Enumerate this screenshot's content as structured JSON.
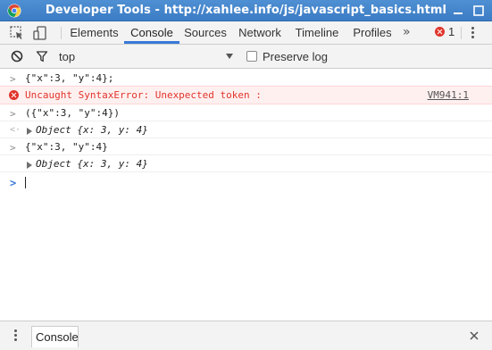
{
  "window": {
    "title": "Developer Tools - http://xahlee.info/js/javascript_basics.html"
  },
  "tabs": [
    {
      "label": "Elements"
    },
    {
      "label": "Console",
      "active": true
    },
    {
      "label": "Sources"
    },
    {
      "label": "Network"
    },
    {
      "label": "Timeline"
    },
    {
      "label": "Profiles"
    }
  ],
  "tabs_more": "»",
  "error_count": "1",
  "console_toolbar": {
    "context": "top",
    "preserve_log_label": "Preserve log",
    "preserve_log_checked": false
  },
  "console": {
    "line1": {
      "prefix": ">",
      "text": "{\"x\":3, \"y\":4};"
    },
    "line2": {
      "text": "Uncaught SyntaxError: Unexpected token :",
      "source": "VM941:1"
    },
    "line3": {
      "prefix": ">",
      "text": "({\"x\":3, \"y\":4})"
    },
    "line4": {
      "prefix": "<·",
      "text": "Object {x: 3, y: 4}"
    },
    "line5": {
      "prefix": ">",
      "text": "{\"x\":3, \"y\":4}"
    },
    "line6": {
      "text": "Object {x: 3, y: 4}"
    },
    "prompt": ">"
  },
  "drawer": {
    "tab_label": "Console"
  },
  "colors": {
    "titlebar": "#4a8ad0",
    "accent": "#3879d9",
    "error": "#e0352b",
    "object_key": "#881391",
    "object_number": "#1c00cf"
  }
}
